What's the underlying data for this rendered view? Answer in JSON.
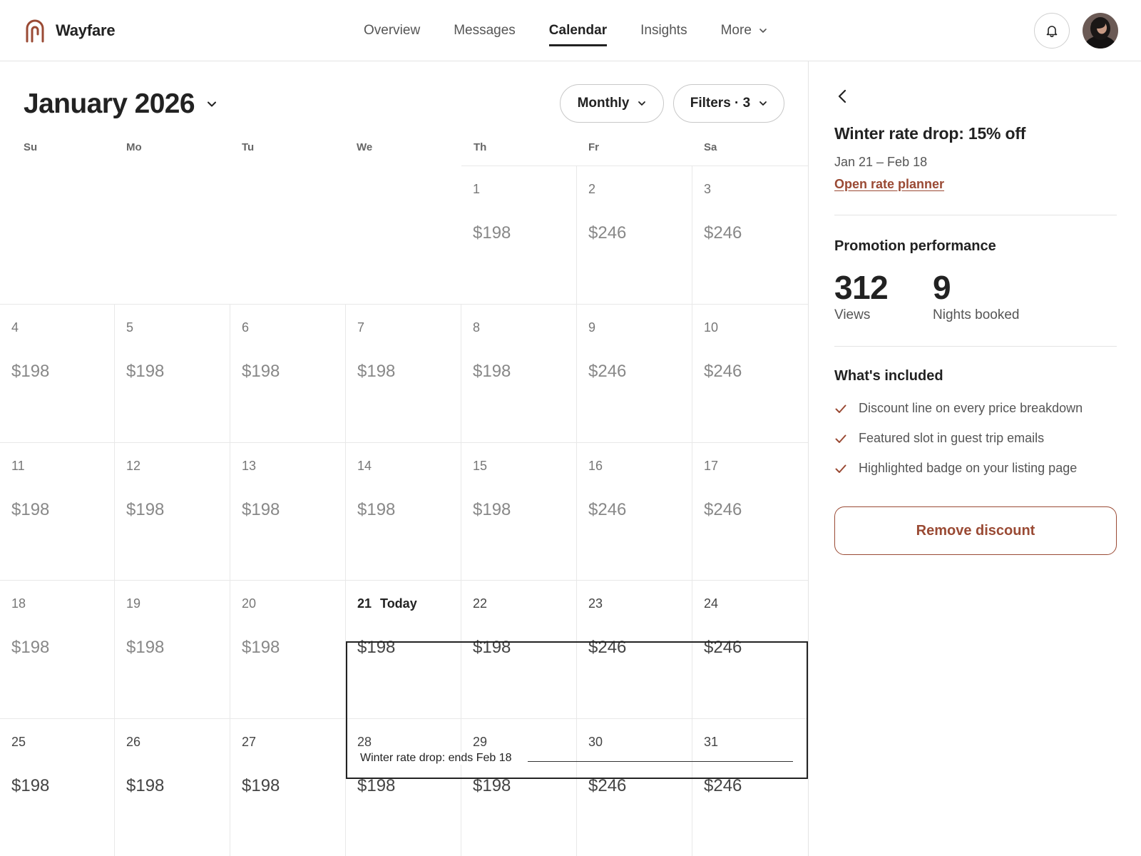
{
  "brand": {
    "name": "Wayfare",
    "accent": "#9a4a34"
  },
  "nav": {
    "items": [
      {
        "label": "Overview",
        "active": false
      },
      {
        "label": "Messages",
        "active": false
      },
      {
        "label": "Calendar",
        "active": true
      },
      {
        "label": "Insights",
        "active": false
      },
      {
        "label": "More",
        "active": false,
        "has_dropdown": true
      }
    ],
    "bell_icon": "bell-icon",
    "avatar": "user-avatar"
  },
  "calendar": {
    "month_title": "January 2026",
    "view_button": "Monthly",
    "filters_button": "Filters · 3",
    "weekdays": [
      "Su",
      "Mo",
      "Tu",
      "We",
      "Th",
      "Fr",
      "Sa"
    ],
    "first_weekday_index": 4,
    "days": [
      {
        "day": "1",
        "price": "$198"
      },
      {
        "day": "2",
        "price": "$246"
      },
      {
        "day": "3",
        "price": "$246"
      },
      {
        "day": "4",
        "price": "$198"
      },
      {
        "day": "5",
        "price": "$198"
      },
      {
        "day": "6",
        "price": "$198"
      },
      {
        "day": "7",
        "price": "$198"
      },
      {
        "day": "8",
        "price": "$198"
      },
      {
        "day": "9",
        "price": "$246"
      },
      {
        "day": "10",
        "price": "$246"
      },
      {
        "day": "11",
        "price": "$198"
      },
      {
        "day": "12",
        "price": "$198"
      },
      {
        "day": "13",
        "price": "$198"
      },
      {
        "day": "14",
        "price": "$198"
      },
      {
        "day": "15",
        "price": "$198"
      },
      {
        "day": "16",
        "price": "$246"
      },
      {
        "day": "17",
        "price": "$246"
      },
      {
        "day": "18",
        "price": "$198"
      },
      {
        "day": "19",
        "price": "$198"
      },
      {
        "day": "20",
        "price": "$198"
      },
      {
        "day": "21",
        "price": "$198"
      },
      {
        "day": "22",
        "price": "$198"
      },
      {
        "day": "23",
        "price": "$246"
      },
      {
        "day": "24",
        "price": "$246"
      },
      {
        "day": "25",
        "price": "$198"
      },
      {
        "day": "26",
        "price": "$198"
      },
      {
        "day": "27",
        "price": "$198"
      },
      {
        "day": "28",
        "price": "$198"
      },
      {
        "day": "29",
        "price": "$198"
      },
      {
        "day": "30",
        "price": "$246"
      },
      {
        "day": "31",
        "price": "$246"
      }
    ],
    "today_day": "21",
    "today_label": "Today",
    "promo_label": "Winter rate drop: ends Feb 18"
  },
  "panel": {
    "title": "Winter rate drop: 15% off",
    "dates": "Jan 21 – Feb 18",
    "link": "Open rate planner",
    "performance_title": "Promotion performance",
    "stats": [
      {
        "value": "312",
        "label": "Views"
      },
      {
        "value": "9",
        "label": "Nights booked"
      }
    ],
    "included_title": "What's included",
    "included": [
      "Discount line on every price breakdown",
      "Featured slot in guest trip emails",
      "Highlighted badge on your listing page"
    ],
    "remove_button": "Remove discount"
  }
}
